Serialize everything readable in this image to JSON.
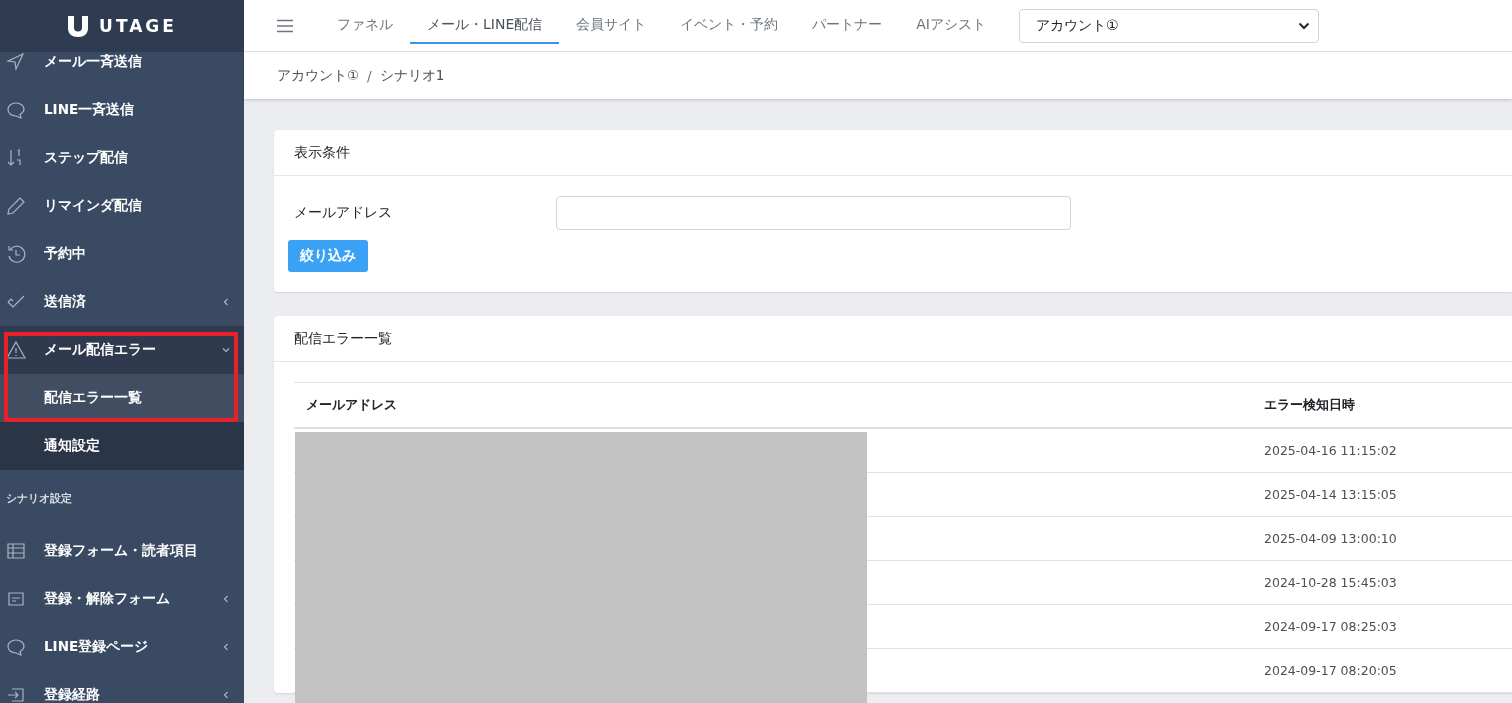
{
  "logo": {
    "text": "UTAGE"
  },
  "sidebar": {
    "items": [
      {
        "kind": "item",
        "label": "メール一斉送信"
      },
      {
        "kind": "item",
        "label": "LINE一斉送信"
      },
      {
        "kind": "item",
        "label": "ステップ配信"
      },
      {
        "kind": "item",
        "label": "リマインダ配信"
      },
      {
        "kind": "item",
        "label": "予約中"
      },
      {
        "kind": "item",
        "label": "送信済",
        "expanded": false
      },
      {
        "kind": "item",
        "label": "メール配信エラー",
        "expanded": true,
        "highlighted": true,
        "children": [
          {
            "label": "配信エラー一覧",
            "selected": true
          },
          {
            "label": "通知設定",
            "selected": false
          }
        ]
      },
      {
        "kind": "header",
        "label": "シナリオ設定"
      },
      {
        "kind": "item",
        "label": "登録フォーム・読者項目"
      },
      {
        "kind": "item",
        "label": "登録・解除フォーム",
        "expanded": false
      },
      {
        "kind": "item",
        "label": "LINE登録ページ",
        "expanded": false
      },
      {
        "kind": "item",
        "label": "登録経路",
        "expanded": false
      }
    ]
  },
  "top_nav": {
    "tabs": [
      {
        "label": "ファネル",
        "selected": false
      },
      {
        "label": "メール・LINE配信",
        "selected": true
      },
      {
        "label": "会員サイト",
        "selected": false
      },
      {
        "label": "イベント・予約",
        "selected": false
      },
      {
        "label": "パートナー",
        "selected": false
      },
      {
        "label": "AIアシスト",
        "selected": false
      }
    ],
    "account_select": "アカウント①"
  },
  "breadcrumb": {
    "items": [
      "アカウント①",
      "シナリオ1"
    ],
    "separator": "/"
  },
  "filter": {
    "title": "表示条件",
    "field_label": "メールアドレス",
    "button": "絞り込み"
  },
  "error_list": {
    "title": "配信エラー一覧",
    "columns": [
      "メールアドレス",
      "エラー検知日時"
    ],
    "rows": [
      {
        "detected_at": "2025-04-16 11:15:02"
      },
      {
        "detected_at": "2025-04-14 13:15:05"
      },
      {
        "detected_at": "2025-04-09 13:00:10"
      },
      {
        "detected_at": "2024-10-28 15:45:03"
      },
      {
        "detected_at": "2024-09-17 08:25:03"
      },
      {
        "detected_at": "2024-09-17 08:20:05"
      }
    ]
  }
}
